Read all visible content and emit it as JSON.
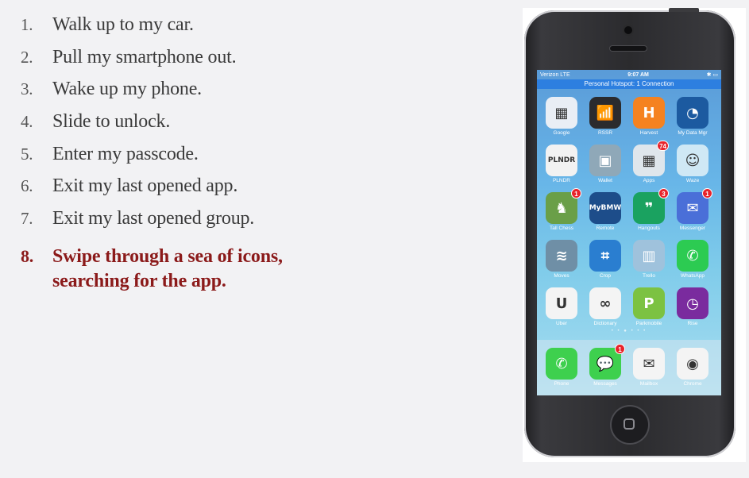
{
  "steps": [
    {
      "num": "1.",
      "text": "Walk up to my car."
    },
    {
      "num": "2.",
      "text": "Pull my smartphone out."
    },
    {
      "num": "3.",
      "text": "Wake up my phone."
    },
    {
      "num": "4.",
      "text": "Slide to unlock."
    },
    {
      "num": "5.",
      "text": "Enter my passcode."
    },
    {
      "num": "6.",
      "text": "Exit my last opened app."
    },
    {
      "num": "7.",
      "text": "Exit my last opened group."
    },
    {
      "num": "8.",
      "text": "Swipe through a sea of icons, searching for the app."
    }
  ],
  "highlight_color": "#8b1a1a",
  "phone": {
    "status": {
      "carrier": "Verizon  LTE",
      "time": "9:07 AM",
      "battery": "✱ ▭"
    },
    "hotspot": "Personal Hotspot: 1 Connection",
    "apps": [
      {
        "label": "Google",
        "icon": "google-folder-icon",
        "glyph": "▦",
        "color": "#e9eef5",
        "badge": ""
      },
      {
        "label": "RSSR",
        "icon": "rssr-icon",
        "glyph": "📶",
        "color": "#2b2b2e",
        "badge": ""
      },
      {
        "label": "Harvest",
        "icon": "harvest-icon",
        "glyph": "H",
        "color": "#f58220",
        "badge": ""
      },
      {
        "label": "My Data Mgr",
        "icon": "data-manager-icon",
        "glyph": "◔",
        "color": "#1c5aa0",
        "badge": ""
      },
      {
        "label": "PLNDR",
        "icon": "plndr-icon",
        "glyph": "PLNDR",
        "color": "#f2f2f2",
        "badge": ""
      },
      {
        "label": "Wallet",
        "icon": "wallet-icon",
        "glyph": "▣",
        "color": "#8fa8b8",
        "badge": ""
      },
      {
        "label": "Apps",
        "icon": "apps-folder-icon",
        "glyph": "▦",
        "color": "#dfe6ec",
        "badge": "74"
      },
      {
        "label": "Waze",
        "icon": "waze-icon",
        "glyph": "☺",
        "color": "#cfe8f5",
        "badge": ""
      },
      {
        "label": "Tall Chess",
        "icon": "tall-chess-icon",
        "glyph": "♞",
        "color": "#6a9f48",
        "badge": "1"
      },
      {
        "label": "Remote",
        "icon": "bmw-remote-icon",
        "glyph": "MyBMW",
        "color": "#1d4d8a",
        "badge": ""
      },
      {
        "label": "Hangouts",
        "icon": "hangouts-icon",
        "glyph": "❞",
        "color": "#1aa260",
        "badge": "3"
      },
      {
        "label": "Messenger",
        "icon": "messenger-icon",
        "glyph": "✉",
        "color": "#4a6fd8",
        "badge": "1"
      },
      {
        "label": "Moves",
        "icon": "moves-icon",
        "glyph": "≋",
        "color": "#6f8fa6",
        "badge": ""
      },
      {
        "label": "Crop",
        "icon": "crop-icon",
        "glyph": "⌗",
        "color": "#2a7ed0",
        "badge": ""
      },
      {
        "label": "Trello",
        "icon": "trello-icon",
        "glyph": "▥",
        "color": "#9fc2dc",
        "badge": ""
      },
      {
        "label": "WhatsApp",
        "icon": "whatsapp-icon",
        "glyph": "✆",
        "color": "#2ccb52",
        "badge": ""
      },
      {
        "label": "Uber",
        "icon": "uber-icon",
        "glyph": "U",
        "color": "#f4f4f4",
        "badge": ""
      },
      {
        "label": "Dictionary",
        "icon": "dictionary-icon",
        "glyph": "∞",
        "color": "#f4f4f4",
        "badge": ""
      },
      {
        "label": "Parkmobile",
        "icon": "parkmobile-icon",
        "glyph": "P",
        "color": "#7cc242",
        "badge": ""
      },
      {
        "label": "Rise",
        "icon": "rise-icon",
        "glyph": "◷",
        "color": "#7a2b9e",
        "badge": ""
      }
    ],
    "dock": [
      {
        "label": "Phone",
        "icon": "phone-icon",
        "glyph": "✆",
        "color": "#3ed04e",
        "badge": ""
      },
      {
        "label": "Messages",
        "icon": "messages-icon",
        "glyph": "💬",
        "color": "#3ed04e",
        "badge": "1"
      },
      {
        "label": "Mailbox",
        "icon": "mailbox-icon",
        "glyph": "✉",
        "color": "#f4f4f4",
        "badge": ""
      },
      {
        "label": "Chrome",
        "icon": "chrome-icon",
        "glyph": "◉",
        "color": "#f4f4f4",
        "badge": ""
      }
    ],
    "page_dots": "• • ● • • •"
  }
}
